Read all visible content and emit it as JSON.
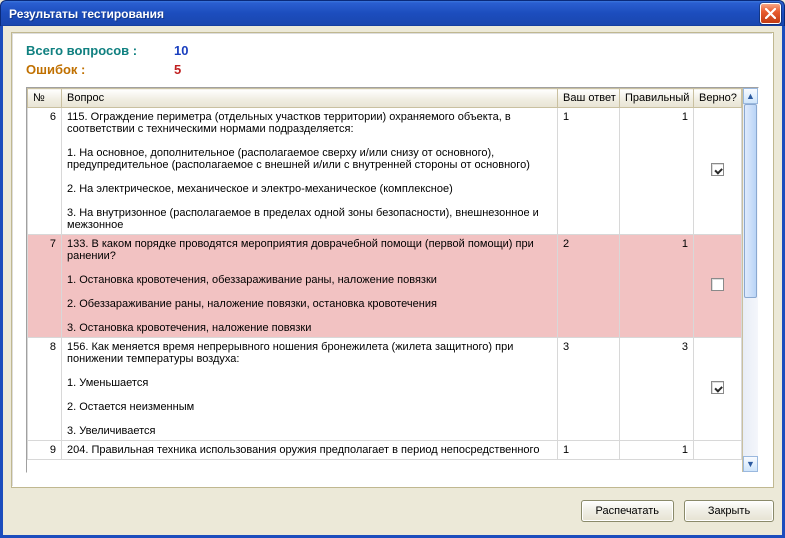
{
  "window": {
    "title": "Результаты тестирования"
  },
  "summary": {
    "total_label": "Всего вопросов :",
    "total_value": "10",
    "errors_label": "Ошибок :",
    "errors_value": "5"
  },
  "columns": {
    "num": "№",
    "question": "Вопрос",
    "your": "Ваш ответ",
    "correct": "Правильный",
    "ok": "Верно?"
  },
  "rows": [
    {
      "n": "6",
      "q": "115. Ограждение периметра (отдельных участков территории) охраняемого объекта, в соответствии с техническими нормами подразделяется:\n\n1. На основное, дополнительное (располагаемое сверху и/или снизу от основного), предупредительное (располагаемое с внешней и/или с внутренней стороны от основного)\n\n2. На электрическое, механическое и электро-механическое (комплексное)\n\n3. На внутризонное (располагаемое в пределах одной зоны безопасности), внешнезонное и межзонное",
      "your": "1",
      "correct": "1",
      "ok": true,
      "wrong": false
    },
    {
      "n": "7",
      "q": "133. В каком порядке проводятся мероприятия доврачебной помощи (первой помощи) при ранении?\n\n1. Остановка кровотечения, обеззараживание раны, наложение повязки\n\n2. Обеззараживание раны, наложение повязки, остановка кровотечения\n\n3. Остановка кровотечения, наложение повязки",
      "your": "2",
      "correct": "1",
      "ok": false,
      "wrong": true
    },
    {
      "n": "8",
      "q": "156.  Как меняется время непрерывного ношения бронежилета (жилета защитного) при понижении температуры воздуха:\n\n1. Уменьшается\n\n2. Остается неизменным\n\n3. Увеличивается",
      "your": "3",
      "correct": "3",
      "ok": true,
      "wrong": false
    },
    {
      "n": "9",
      "q": "204. Правильная техника использования оружия предполагает в период непосредственного",
      "your": "1",
      "correct": "1",
      "ok": null,
      "wrong": false
    }
  ],
  "buttons": {
    "print": "Распечатать",
    "close": "Закрыть"
  }
}
